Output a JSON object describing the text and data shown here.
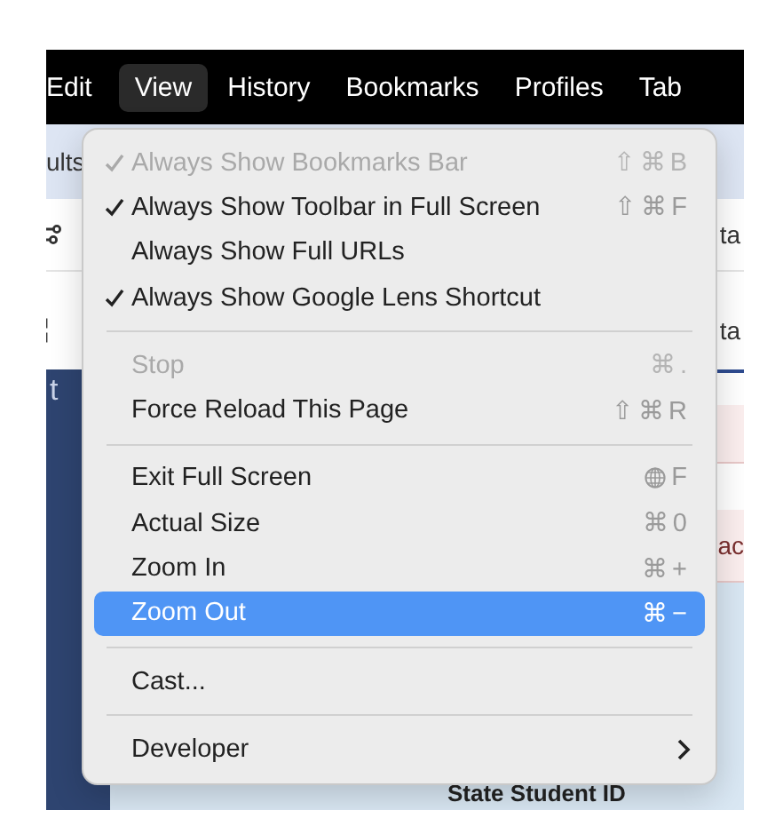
{
  "menu_bar": [
    {
      "label": "Edit",
      "selected": false
    },
    {
      "label": "View",
      "selected": true
    },
    {
      "label": "History",
      "selected": false
    },
    {
      "label": "Bookmarks",
      "selected": false
    },
    {
      "label": "Profiles",
      "selected": false
    },
    {
      "label": "Tab",
      "selected": false
    }
  ],
  "background": {
    "tab_fragment": "ults",
    "toolbar_fragment": "ta",
    "row_fragment": "ta",
    "sidebar_fragment": "t",
    "alert_fragment": "ac",
    "field_label": "State Student ID"
  },
  "menu": [
    {
      "kind": "item",
      "label": "Always Show Bookmarks Bar",
      "shortcut": "⇧⌘B",
      "checked": true,
      "disabled": true,
      "selected": false
    },
    {
      "kind": "item",
      "label": "Always Show Toolbar in Full Screen",
      "shortcut": "⇧⌘F",
      "checked": true,
      "disabled": false,
      "selected": false
    },
    {
      "kind": "item",
      "label": "Always Show Full URLs",
      "checked": false,
      "disabled": false,
      "selected": false
    },
    {
      "kind": "item",
      "label": "Always Show Google Lens Shortcut",
      "checked": true,
      "disabled": false,
      "selected": false
    },
    {
      "kind": "separator"
    },
    {
      "kind": "item",
      "label": "Stop",
      "shortcut": "⌘.",
      "checked": false,
      "disabled": true,
      "selected": false
    },
    {
      "kind": "item",
      "label": "Force Reload This Page",
      "shortcut": "⇧⌘R",
      "checked": false,
      "disabled": false,
      "selected": false
    },
    {
      "kind": "separator"
    },
    {
      "kind": "item",
      "label": "Exit Full Screen",
      "shortcut": "F",
      "globe": true,
      "checked": false,
      "disabled": false,
      "selected": false
    },
    {
      "kind": "item",
      "label": "Actual Size",
      "shortcut": "⌘0",
      "checked": false,
      "disabled": false,
      "selected": false
    },
    {
      "kind": "item",
      "label": "Zoom In",
      "shortcut": "⌘+",
      "checked": false,
      "disabled": false,
      "selected": false
    },
    {
      "kind": "item",
      "label": "Zoom Out",
      "shortcut": "⌘−",
      "checked": false,
      "disabled": false,
      "selected": true
    },
    {
      "kind": "separator"
    },
    {
      "kind": "item",
      "label": "Cast...",
      "checked": false,
      "disabled": false,
      "selected": false
    },
    {
      "kind": "separator"
    },
    {
      "kind": "item",
      "label": "Developer",
      "submenu": true,
      "checked": false,
      "disabled": false,
      "selected": false
    }
  ]
}
